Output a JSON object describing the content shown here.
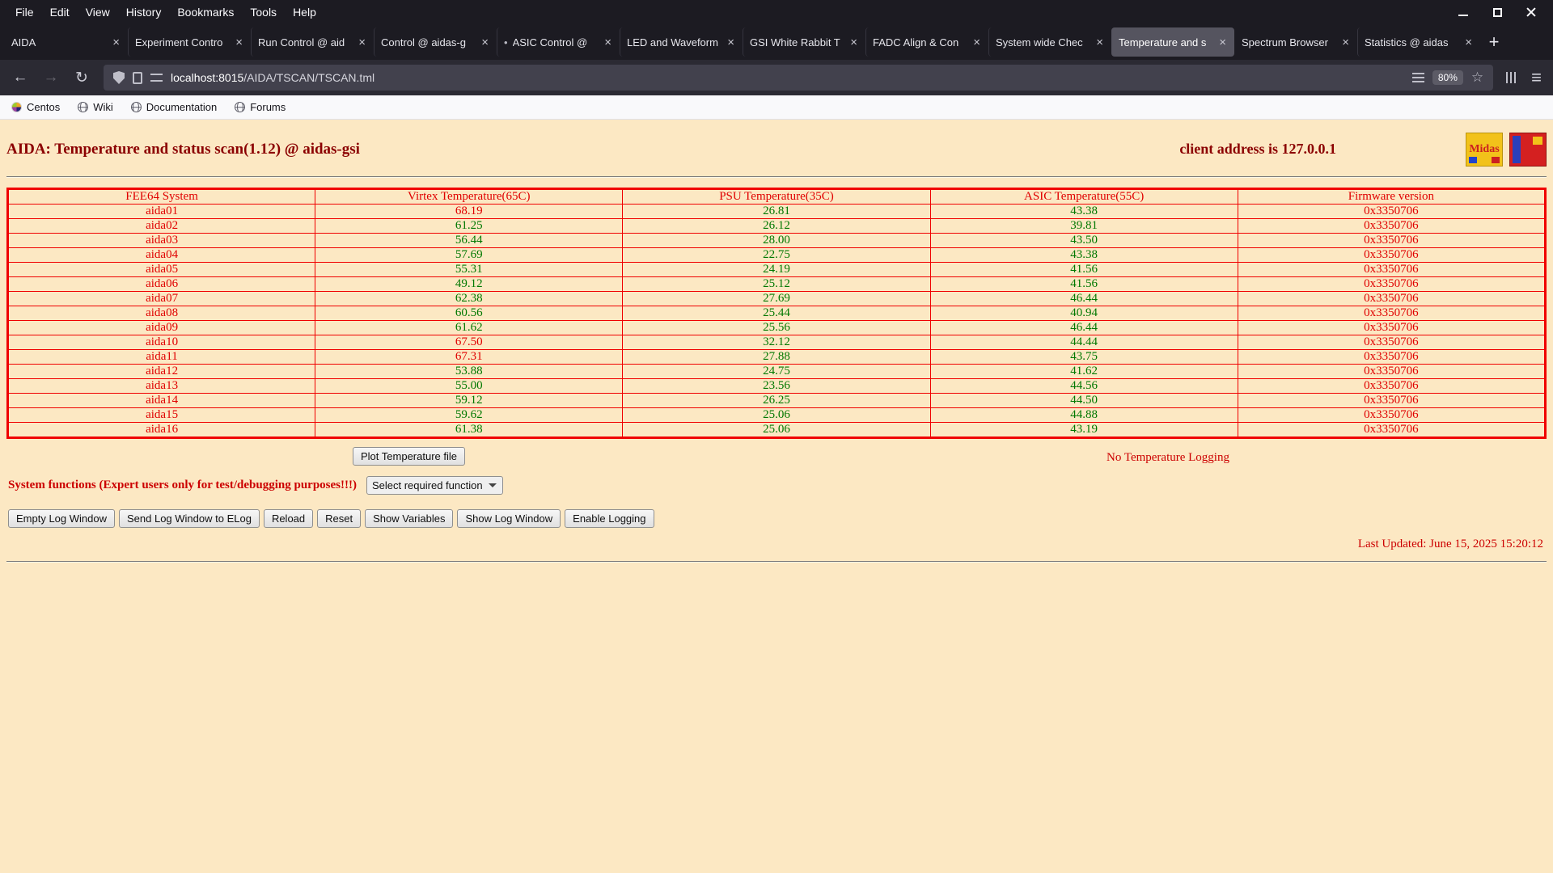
{
  "browser": {
    "menu": [
      "File",
      "Edit",
      "View",
      "History",
      "Bookmarks",
      "Tools",
      "Help"
    ],
    "tabs": [
      {
        "label": "AIDA"
      },
      {
        "label": "Experiment Contro"
      },
      {
        "label": "Run Control @ aid"
      },
      {
        "label": "Control @ aidas-g"
      },
      {
        "label": "ASIC Control @",
        "dot": true
      },
      {
        "label": "LED and Waveform"
      },
      {
        "label": "GSI White Rabbit T"
      },
      {
        "label": "FADC Align & Con"
      },
      {
        "label": "System wide Chec"
      },
      {
        "label": "Temperature and s",
        "active": true
      },
      {
        "label": "Spectrum Browser"
      },
      {
        "label": "Statistics @ aidas"
      }
    ],
    "url_host": "localhost:8015",
    "url_path": "/AIDA/TSCAN/TSCAN.tml",
    "zoom": "80%",
    "bookmarks": [
      "Centos",
      "Wiki",
      "Documentation",
      "Forums"
    ]
  },
  "icons": {
    "close": "×",
    "plus": "+",
    "back": "←",
    "forward": "→",
    "reload": "↻",
    "star": "☆",
    "hamburger": "≡",
    "dot": "•"
  },
  "page": {
    "title": "AIDA: Temperature and status scan(1.12) @ aidas-gsi",
    "client_address": "client address is 127.0.0.1",
    "midas_label": "Midas",
    "plot_button": "Plot Temperature file",
    "no_logging": "No Temperature Logging",
    "system_functions_label": "System functions (Expert users only for test/debugging purposes!!!)",
    "select_placeholder": "Select required function",
    "action_buttons": [
      "Empty Log Window",
      "Send Log Window to ELog",
      "Reload",
      "Reset",
      "Show Variables",
      "Show Log Window",
      "Enable Logging"
    ],
    "last_updated": "Last Updated: June 15, 2025 15:20:12"
  },
  "table": {
    "headers": [
      "FEE64 System",
      "Virtex Temperature(65C)",
      "PSU Temperature(35C)",
      "ASIC Temperature(55C)",
      "Firmware version"
    ],
    "rows": [
      {
        "name": "aida01",
        "virtex": "68.19",
        "virtex_alarm": true,
        "psu": "26.81",
        "asic": "43.38",
        "firmware": "0x3350706"
      },
      {
        "name": "aida02",
        "virtex": "61.25",
        "virtex_alarm": false,
        "psu": "26.12",
        "asic": "39.81",
        "firmware": "0x3350706"
      },
      {
        "name": "aida03",
        "virtex": "56.44",
        "virtex_alarm": false,
        "psu": "28.00",
        "asic": "43.50",
        "firmware": "0x3350706"
      },
      {
        "name": "aida04",
        "virtex": "57.69",
        "virtex_alarm": false,
        "psu": "22.75",
        "asic": "43.38",
        "firmware": "0x3350706"
      },
      {
        "name": "aida05",
        "virtex": "55.31",
        "virtex_alarm": false,
        "psu": "24.19",
        "asic": "41.56",
        "firmware": "0x3350706"
      },
      {
        "name": "aida06",
        "virtex": "49.12",
        "virtex_alarm": false,
        "psu": "25.12",
        "asic": "41.56",
        "firmware": "0x3350706"
      },
      {
        "name": "aida07",
        "virtex": "62.38",
        "virtex_alarm": false,
        "psu": "27.69",
        "asic": "46.44",
        "firmware": "0x3350706"
      },
      {
        "name": "aida08",
        "virtex": "60.56",
        "virtex_alarm": false,
        "psu": "25.44",
        "asic": "40.94",
        "firmware": "0x3350706"
      },
      {
        "name": "aida09",
        "virtex": "61.62",
        "virtex_alarm": false,
        "psu": "25.56",
        "asic": "46.44",
        "firmware": "0x3350706"
      },
      {
        "name": "aida10",
        "virtex": "67.50",
        "virtex_alarm": true,
        "psu": "32.12",
        "asic": "44.44",
        "firmware": "0x3350706"
      },
      {
        "name": "aida11",
        "virtex": "67.31",
        "virtex_alarm": true,
        "psu": "27.88",
        "asic": "43.75",
        "firmware": "0x3350706"
      },
      {
        "name": "aida12",
        "virtex": "53.88",
        "virtex_alarm": false,
        "psu": "24.75",
        "asic": "41.62",
        "firmware": "0x3350706"
      },
      {
        "name": "aida13",
        "virtex": "55.00",
        "virtex_alarm": false,
        "psu": "23.56",
        "asic": "44.56",
        "firmware": "0x3350706"
      },
      {
        "name": "aida14",
        "virtex": "59.12",
        "virtex_alarm": false,
        "psu": "26.25",
        "asic": "44.50",
        "firmware": "0x3350706"
      },
      {
        "name": "aida15",
        "virtex": "59.62",
        "virtex_alarm": false,
        "psu": "25.06",
        "asic": "44.88",
        "firmware": "0x3350706"
      },
      {
        "name": "aida16",
        "virtex": "61.38",
        "virtex_alarm": false,
        "psu": "25.06",
        "asic": "43.19",
        "firmware": "0x3350706"
      }
    ]
  }
}
